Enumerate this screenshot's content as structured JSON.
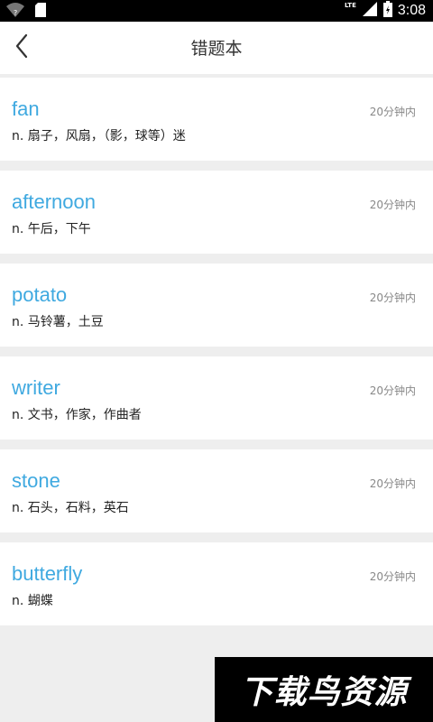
{
  "status_bar": {
    "time": "3:08",
    "network": "LTE",
    "icons": [
      "wifi-icon",
      "sim-card-icon",
      "signal-icon",
      "battery-icon"
    ]
  },
  "header": {
    "title": "错题本",
    "back_icon": "chevron-left-icon"
  },
  "words": [
    {
      "word": "fan",
      "meaning": "n. 扇子，风扇，（影，球等）迷",
      "time": "20分钟内"
    },
    {
      "word": "afternoon",
      "meaning": "n. 午后，下午",
      "time": "20分钟内"
    },
    {
      "word": "potato",
      "meaning": "n. 马铃薯，土豆",
      "time": "20分钟内"
    },
    {
      "word": "writer",
      "meaning": "n. 文书，作家，作曲者",
      "time": "20分钟内"
    },
    {
      "word": "stone",
      "meaning": "n. 石头，石料，英石",
      "time": "20分钟内"
    },
    {
      "word": "butterfly",
      "meaning": "n. 蝴蝶",
      "time": "20分钟内"
    }
  ],
  "watermark": "下载鸟资源",
  "colors": {
    "word": "#3fa9e0",
    "background": "#eeeeee",
    "card": "#ffffff",
    "status_bar": "#000000"
  }
}
